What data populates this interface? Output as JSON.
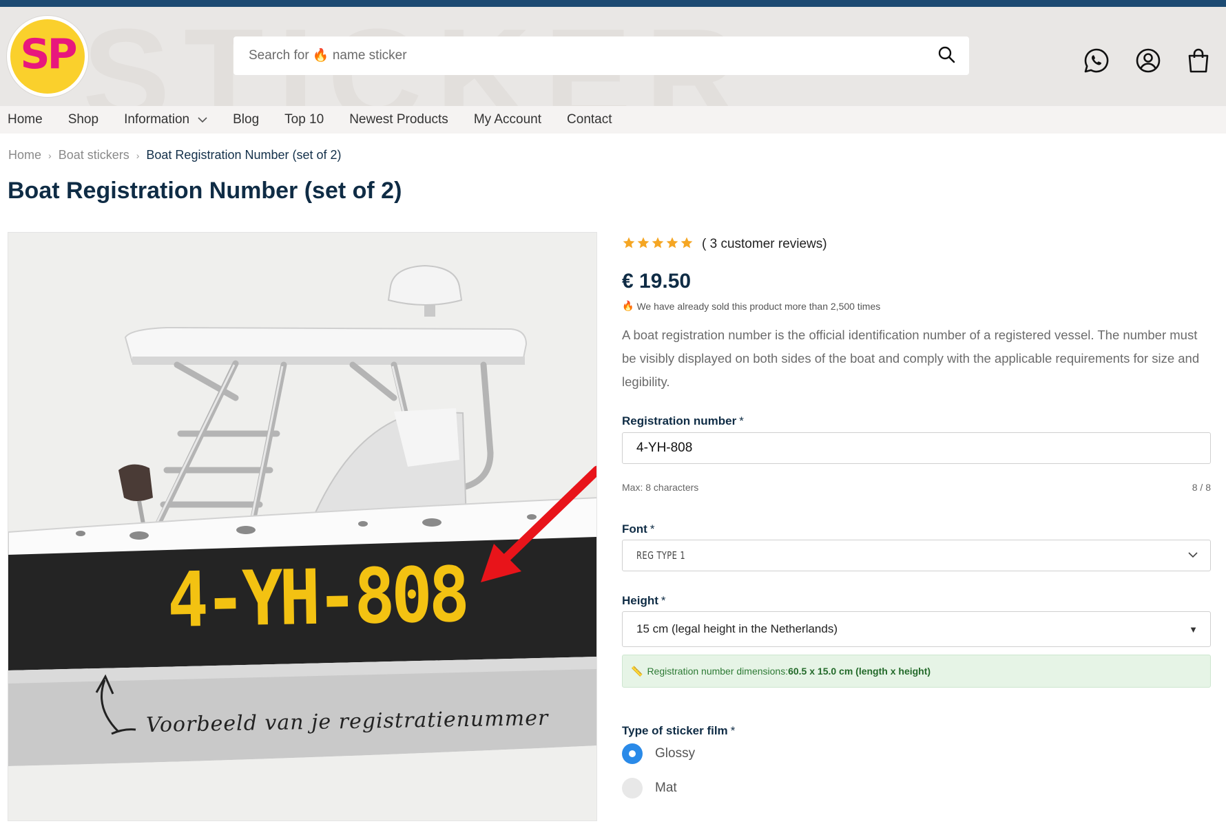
{
  "header": {
    "logo_text": "SP",
    "search_placeholder": "Search for 🔥 name sticker",
    "icons": [
      "search-icon",
      "whatsapp-icon",
      "account-icon",
      "cart-icon"
    ]
  },
  "nav": {
    "items": [
      "Home",
      "Shop",
      "Information",
      "Blog",
      "Top 10",
      "Newest Products",
      "My Account",
      "Contact"
    ]
  },
  "breadcrumb": {
    "items": [
      "Home",
      "Boat stickers",
      "Boat Registration Number (set of 2)"
    ]
  },
  "product": {
    "title": "Boat Registration Number (set of 2)",
    "rating": 5,
    "reviews": "( 3 customer reviews)",
    "price": "€ 19.50",
    "sold_note": "We have already sold this product more than 2,500 times",
    "description": "A boat registration number is the official identification number of a registered vessel. The number must be visibly displayed on both sides of the boat and comply with the applicable requirements for size and legibility.",
    "image": {
      "registration_text": "4-YH-808",
      "caption": "Voorbeeld van je registratienummer"
    }
  },
  "form": {
    "registration": {
      "label": "Registration number",
      "required": "*",
      "value": "4-YH-808",
      "hint": "Max: 8 characters",
      "counter": "8 / 8"
    },
    "font": {
      "label": "Font",
      "required": "*",
      "value": "REG TYPE 1"
    },
    "height": {
      "label": "Height",
      "required": "*",
      "value": "15 cm (legal height in the Netherlands)"
    },
    "dimensions": {
      "prefix": "Registration number dimensions:",
      "value": "60.5 x 15.0 cm (length x height)"
    },
    "film": {
      "label": "Type of sticker film",
      "required": "*",
      "options": [
        "Glossy",
        "Mat"
      ],
      "selected": "Glossy"
    }
  },
  "colors": {
    "topbar": "#1c4a72",
    "brand_yellow": "#fad02c",
    "brand_pink": "#e8177d",
    "star": "#f5a623",
    "radio_selected": "#2a8ae8",
    "notice_text": "#2d7a34"
  }
}
